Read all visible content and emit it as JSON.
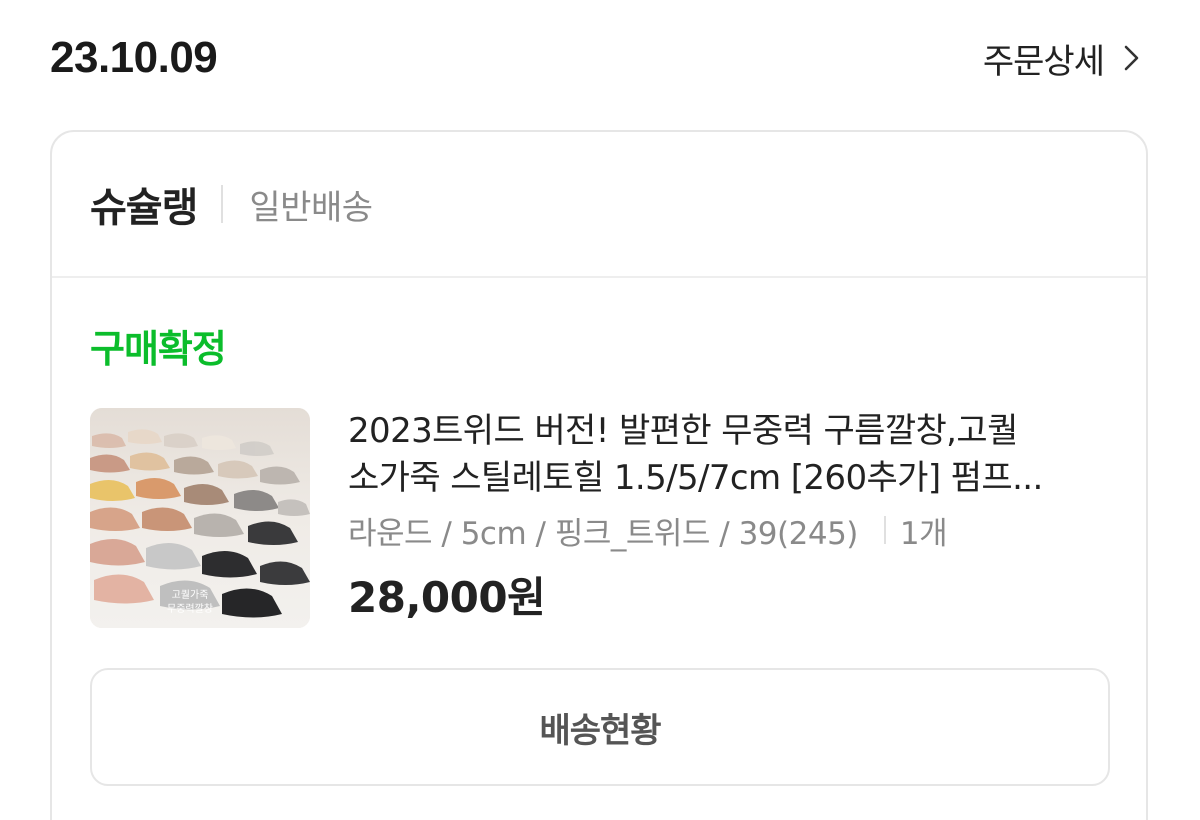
{
  "order": {
    "date": "23.10.09",
    "detail_label": "주문상세"
  },
  "store": {
    "name": "슈슐랭",
    "delivery_type": "일반배송"
  },
  "status": {
    "label": "구매확정",
    "color": "#0bbd2b"
  },
  "product": {
    "title": "2023트위드 버전! 발편한 무중력 구름깔창,고퀄 소가죽 스틸레토힐 1.5/5/7cm [260추가] 펌프...",
    "options": "라운드 / 5cm / 핑크_트위드 / 39(245)",
    "quantity": "1개",
    "price": "28,000원",
    "thumbnail_caption_line1": "고퀄가죽",
    "thumbnail_caption_line2": "무중력깔창"
  },
  "actions": {
    "track_label": "배송현황"
  },
  "icons": {
    "detail_chevron": "chevron-right-icon"
  }
}
